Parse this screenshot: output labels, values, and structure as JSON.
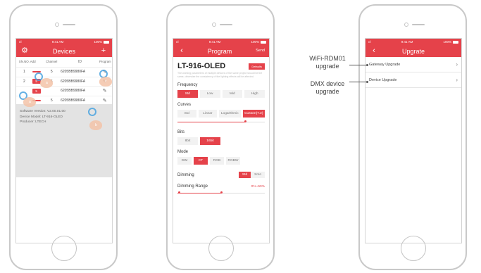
{
  "status": {
    "signal": "ııl",
    "time": "9:41 AM",
    "battery": "100%"
  },
  "screen1": {
    "title": "Devices",
    "settings_icon": "gear-icon",
    "add_icon": "plus-icon",
    "columns": [
      "SN.NO.",
      "Add",
      "Channel",
      "ID",
      "Program"
    ],
    "rows": [
      {
        "sn": "1",
        "addr": "",
        "channel": "5",
        "id": "6205BB9980FA"
      },
      {
        "sn": "2",
        "addr": "5",
        "channel": "5",
        "id": "6205BB9980FA"
      },
      {
        "sn": "",
        "addr": "5",
        "channel": "",
        "id": "6205BB9980FA"
      },
      {
        "sn": "",
        "addr": "",
        "channel": "5",
        "id": "6205BB9980FA"
      }
    ],
    "info": [
      "Software Version: V2.00.01.00",
      "Device Model: LT-916-OLED",
      "Producer: LTECH"
    ],
    "hand_labels": [
      "a",
      "a",
      "b",
      "c"
    ]
  },
  "screen2": {
    "title": "Program",
    "back": "‹",
    "send": "Send",
    "product": "LT-916-OLED",
    "defaults": "Defaults",
    "warning": "The working parameters of multiple devices of the same project should be the same, otherwise the consistency of the lighting effects will be affected.",
    "frequency": {
      "label": "Frequency",
      "options": [
        "Std",
        "Low",
        "Mid",
        "High"
      ],
      "selected": 0
    },
    "curves": {
      "label": "Curves",
      "options": [
        "Std",
        "Linear",
        "Logarithmic",
        "Custom(7.2)"
      ],
      "selected": 3,
      "slider_pct": 0.78
    },
    "bits": {
      "label": "Bits",
      "options": [
        "8bit",
        "16bit"
      ],
      "selected": 1
    },
    "mode": {
      "label": "Mode",
      "options": [
        "DIM",
        "CT",
        "RGB",
        "RGBW"
      ],
      "selected": 1
    },
    "dimming": {
      "label": "Dimming",
      "options": [
        "Std",
        "Smo"
      ],
      "selected": 0
    },
    "range": {
      "label": "Dimming Range",
      "value": "0%~50%",
      "low_pct": 0.0,
      "high_pct": 0.5
    }
  },
  "screen3": {
    "title": "Upgrate",
    "back": "‹",
    "items": [
      "Gateway Upgrade",
      "Device Upgrade"
    ],
    "annotations": [
      {
        "line1": "WiFi-RDM01",
        "line2": "upgrade"
      },
      {
        "line1": "DMX device",
        "line2": "upgrade"
      }
    ]
  },
  "colors": {
    "brand_red": "#e5424a",
    "info_gray": "#e3e3e3"
  }
}
